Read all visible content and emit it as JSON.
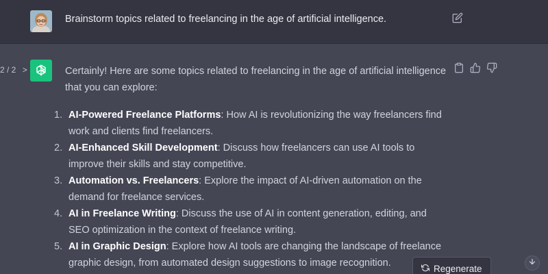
{
  "user_message": {
    "text": "Brainstorm topics related to freelancing in the age of artificial intelligence.",
    "edit_icon": "pencil-square-icon",
    "avatar": "user-avatar"
  },
  "assistant_message": {
    "pager": {
      "prev": "<",
      "label": "2 / 2",
      "next": ">"
    },
    "intro": "Certainly! Here are some topics related to freelancing in the age of artificial intelligence that you can explore:",
    "items": [
      {
        "num": "1.",
        "title": "AI-Powered Freelance Platforms",
        "text": ": How AI is revolutionizing the way freelancers find work and clients find freelancers."
      },
      {
        "num": "2.",
        "title": "AI-Enhanced Skill Development",
        "text": ": Discuss how freelancers can use AI tools to improve their skills and stay competitive."
      },
      {
        "num": "3.",
        "title": "Automation vs. Freelancers",
        "text": ": Explore the impact of AI-driven automation on the demand for freelance services."
      },
      {
        "num": "4.",
        "title": "AI in Freelance Writing",
        "text": ": Discuss the use of AI in content generation, editing, and SEO optimization in the context of freelance writing."
      },
      {
        "num": "5.",
        "title": "AI in Graphic Design",
        "text": ": Explore how AI tools are changing the landscape of freelance graphic design, from automated design suggestions to image recognition."
      }
    ],
    "actions": [
      "clipboard-icon",
      "thumbs-up-icon",
      "thumbs-down-icon"
    ]
  },
  "regenerate_label": "Regenerate",
  "colors": {
    "user_bg": "#343541",
    "assistant_bg": "#444654",
    "brand_green": "#19c37d"
  }
}
